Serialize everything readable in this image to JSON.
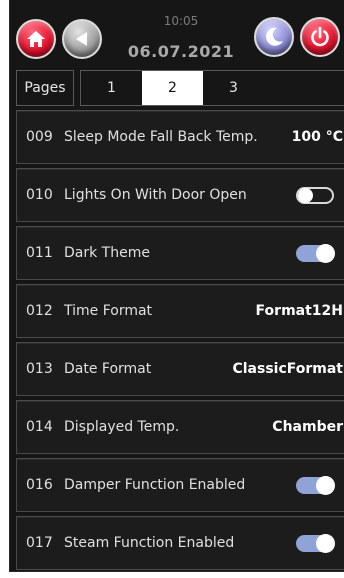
{
  "header": {
    "time": "10:05",
    "date": "06.07.2021",
    "buttons": {
      "home": "home-icon",
      "back": "back-arrow-icon",
      "night": "moon-icon",
      "power": "power-icon"
    },
    "colors": {
      "red": "#e8152f",
      "gray": "#9b9b9b",
      "purple": "#8d8dd6"
    }
  },
  "tabs": {
    "title": "Pages",
    "items": [
      "1",
      "2",
      "3"
    ],
    "active": "2"
  },
  "settings": [
    {
      "code": "009",
      "label": "Sleep Mode Fall Back Temp.",
      "value": "100 °C"
    },
    {
      "code": "010",
      "label": "Lights On With Door Open",
      "toggle": false
    },
    {
      "code": "011",
      "label": "Dark Theme",
      "toggle": true
    },
    {
      "code": "012",
      "label": "Time Format",
      "value": "Format12H"
    },
    {
      "code": "013",
      "label": "Date Format",
      "value": "ClassicFormat"
    },
    {
      "code": "014",
      "label": "Displayed Temp.",
      "value": "Chamber"
    },
    {
      "code": "016",
      "label": "Damper Function Enabled",
      "toggle": true
    },
    {
      "code": "017",
      "label": "Steam Function Enabled",
      "toggle": true
    }
  ],
  "theme": {
    "toggle_on": "#8fa3d6",
    "background": "#161616"
  }
}
